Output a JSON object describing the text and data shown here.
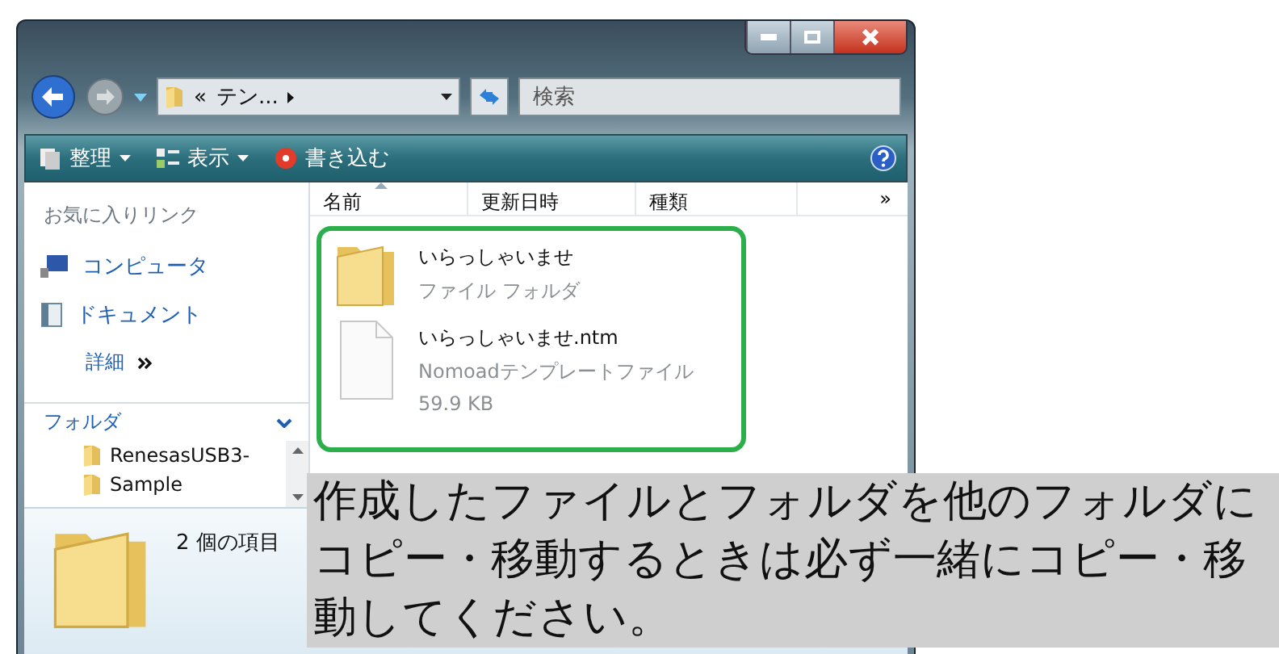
{
  "address": {
    "prefix": "«",
    "path": "テン..."
  },
  "search": {
    "placeholder": "検索"
  },
  "toolbar": [
    {
      "label": "整理",
      "kind": "organize"
    },
    {
      "label": "表示",
      "kind": "views"
    },
    {
      "label": "書き込む",
      "kind": "burn"
    }
  ],
  "sidebar": {
    "favorites_title": "お気に入りリンク",
    "links": [
      {
        "label": "コンピュータ",
        "kind": "computer"
      },
      {
        "label": "ドキュメント",
        "kind": "documents"
      }
    ],
    "more": "詳細",
    "folders_title": "フォルダ",
    "tree": [
      "RenesasUSB3-",
      "Sample"
    ]
  },
  "columns": [
    {
      "label": "名前",
      "sorted": true
    },
    {
      "label": "更新日時",
      "sorted": false
    },
    {
      "label": "種類",
      "sorted": false
    }
  ],
  "more_columns": "»",
  "files": [
    {
      "kind": "folder",
      "name": "いらっしゃいませ",
      "lines": [
        "ファイル フォルダ"
      ]
    },
    {
      "kind": "file",
      "name": "いらっしゃいませ.ntm",
      "lines": [
        "Nomoadテンプレートファイル",
        "59.9 KB"
      ]
    }
  ],
  "details": {
    "count": "2 個の項目"
  },
  "callout": {
    "text": "作成したファイルとフォルダを他のフォルダにコピー・移動するときは必ず一緒にコピー・移動してください。"
  }
}
